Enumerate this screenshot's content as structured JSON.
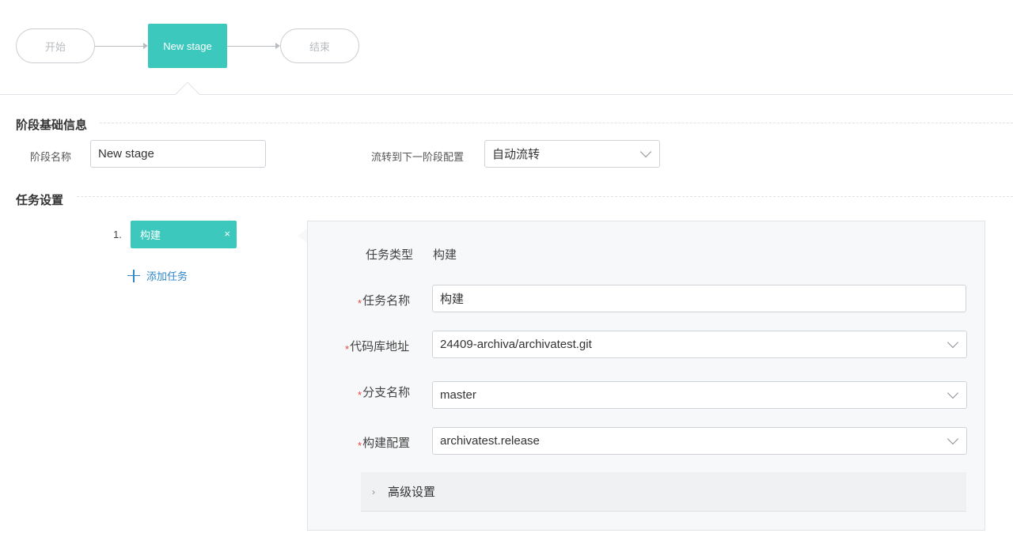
{
  "flow": {
    "start_label": "开始",
    "stage_label": "New stage",
    "end_label": "结束"
  },
  "basic_info": {
    "section_title": "阶段基础信息",
    "stage_name_label": "阶段名称",
    "stage_name_value": "New stage",
    "transition_label": "流转到下一阶段配置",
    "transition_value": "自动流转"
  },
  "task_settings": {
    "section_title": "任务设置",
    "tasks": [
      {
        "index": "1.",
        "name": "构建",
        "remove_icon": "×"
      }
    ],
    "add_task_label": "添加任务"
  },
  "task_detail": {
    "type_label": "任务类型",
    "type_value": "构建",
    "required_mark": "*",
    "name_label": "任务名称",
    "name_value": "构建",
    "repo_label": "代码库地址",
    "repo_value": "24409-archiva/archivatest.git",
    "branch_label": "分支名称",
    "branch_value": "master",
    "build_config_label": "构建配置",
    "build_config_value": "archivatest.release",
    "advanced_label": "高级设置",
    "advanced_caret": "›"
  },
  "colors": {
    "accent": "#3cc8bd",
    "link": "#2e87c8",
    "required": "#e0473e"
  }
}
